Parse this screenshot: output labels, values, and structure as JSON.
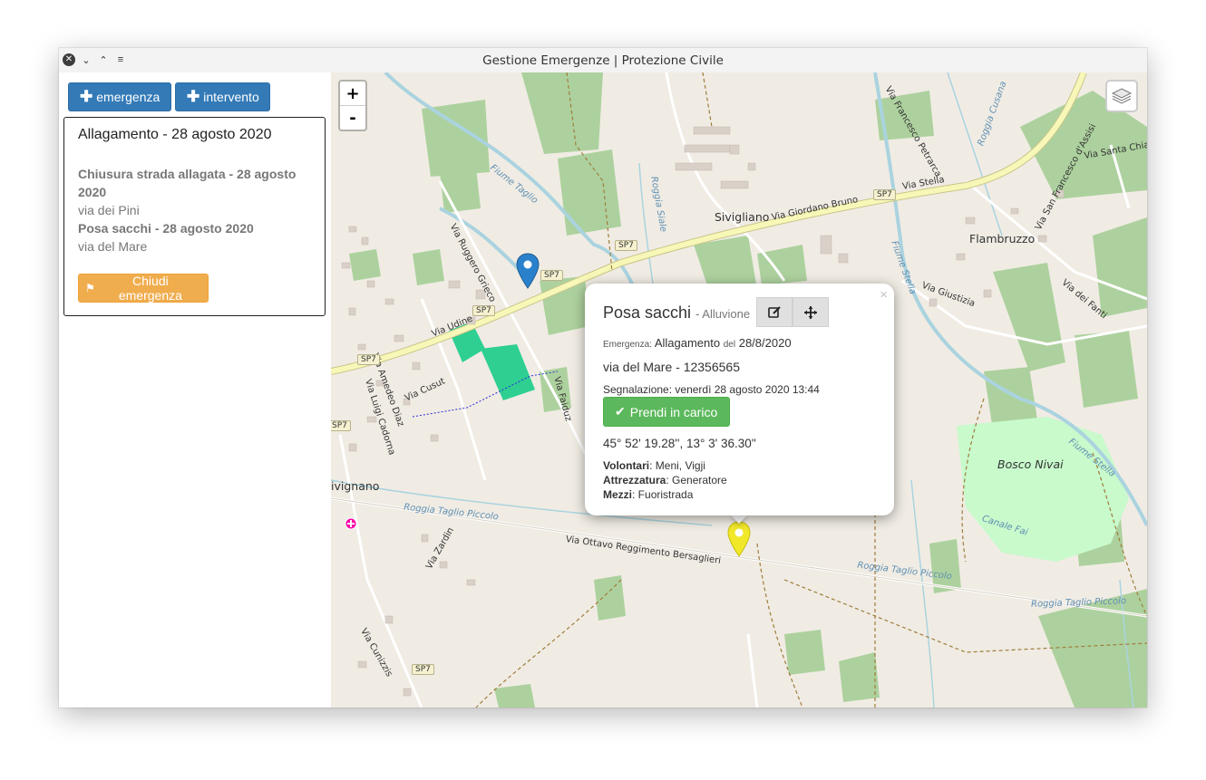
{
  "window": {
    "title": "Gestione Emergenze | Protezione Civile"
  },
  "toolbar": {
    "emergenza_label": "emergenza",
    "intervento_label": "intervento"
  },
  "emergency": {
    "title": "Allagamento - 28 agosto 2020",
    "interventions": [
      {
        "title": "Chiusura strada allagata - 28 agosto 2020",
        "address": "via dei Pini"
      },
      {
        "title": "Posa sacchi - 28 agosto 2020",
        "address": "via del Mare"
      }
    ],
    "close_label": "Chiudi emergenza"
  },
  "map": {
    "zoom_in": "+",
    "zoom_out": "-",
    "labels": {
      "sivigliano": "Sivigliano",
      "flambruzzo": "Flambruzzo",
      "rivignano": "ivignano",
      "bosco": "Bosco Nivai",
      "via_udine": "Via Udine",
      "via_giordano": "Via Giordano Bruno",
      "via_stella": "Via Stella",
      "via_ottavo": "Via Ottavo Reggimento Bersaglieri",
      "fiume_taglio": "Fiume Taglio",
      "fiume_stella": "Fiume Stella",
      "fiume_stella2": "Fiume Stella",
      "roggia_taglio": "Roggia Taglio Piccolo",
      "roggia_taglio2": "Roggia Taglio Piccolo",
      "roggia_taglio3": "Roggia Taglio Piccolo",
      "canale_fai": "Canale Fai",
      "via_ruggero": "Via Ruggero Grieco",
      "via_faiduz": "Via Faiduz",
      "via_giustizia": "Via Giustizia",
      "via_fanti": "Via dei Fanti",
      "via_santa_chiara": "Via Santa Chiara",
      "via_francesco": "Via Francesco Petrarca",
      "via_san_francesco": "Via San Francesco d'Assisi",
      "via_amedeo": "Via Amedeo Diaz",
      "via_luigi": "Via Luigi Cadorna",
      "via_cusut": "Via Cusut",
      "via_zardin": "Via Zardin",
      "via_cunizzis": "Via Cunizzis",
      "roggia_cusana": "Roggia Cusana",
      "roggia_siale": "Roggia Siale",
      "sp7": "SP7"
    }
  },
  "popup": {
    "title": "Posa sacchi",
    "type": "- Alluvione",
    "emergenza_prefix": "Emergenza:",
    "emergenza_name": "Allagamento",
    "del_label": "del",
    "emergenza_date": "28/8/2020",
    "address": "via del Mare - 12356565",
    "segnalazione": "Segnalazione: venerdì 28 agosto 2020 13:44",
    "take_label": "Prendi in carico",
    "coords": "45° 52' 19.28'', 13° 3' 36.30''",
    "volontari_label": "Volontari",
    "volontari": ": Meni, Vigji",
    "attrezzatura_label": "Attrezzatura",
    "attrezzatura": ": Generatore",
    "mezzi_label": "Mezzi",
    "mezzi": ": Fuoristrada",
    "close": "×"
  },
  "colors": {
    "primary": "#337ab7",
    "warning": "#f0ad4e",
    "success": "#5cb85c",
    "marker_blue": "#2a81cb",
    "marker_yellow": "#f2e82a",
    "field": "#add19e",
    "road_major": "#f7f7b8",
    "water": "#aad3df"
  }
}
